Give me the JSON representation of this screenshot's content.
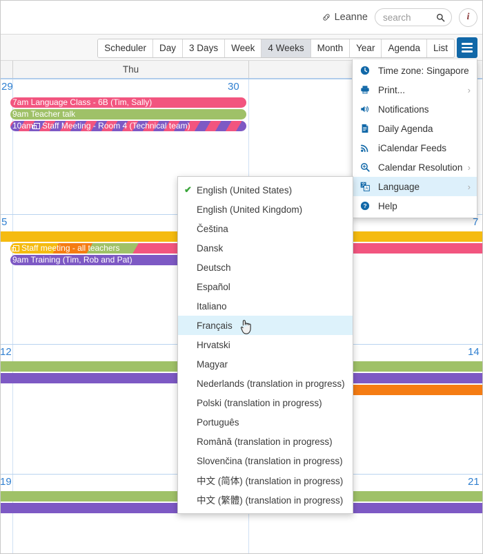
{
  "topbar": {
    "user_name": "Leanne",
    "link_icon": "link-icon",
    "search_placeholder": "search",
    "search_value": "",
    "search_icon": "search-icon",
    "info_label": "i"
  },
  "viewbar": {
    "views": [
      {
        "label": "Scheduler",
        "active": false
      },
      {
        "label": "Day",
        "active": false
      },
      {
        "label": "3 Days",
        "active": false
      },
      {
        "label": "Week",
        "active": false
      },
      {
        "label": "4 Weeks",
        "active": true
      },
      {
        "label": "Month",
        "active": false
      },
      {
        "label": "Year",
        "active": false
      },
      {
        "label": "Agenda",
        "active": false
      },
      {
        "label": "List",
        "active": false
      }
    ],
    "menu_button_icon": "hamburger-icon"
  },
  "calendar": {
    "day_headers": [
      "",
      "Thu",
      ""
    ],
    "weeks": [
      {
        "day_numbers": [
          "29",
          "30",
          ""
        ],
        "events": [
          {
            "title": "7am Language Class - 6B (Tim, Sally)",
            "color": "#f2557f",
            "style": "solid",
            "recurring": false
          },
          {
            "title": "9am Teacher talk",
            "color": "#9fc168",
            "style": "solid",
            "recurring": false
          },
          {
            "title": "10am Staff Meeting - Room 4 (Technical team)",
            "color": "#7d59c4",
            "style": "striped",
            "recurring": true
          }
        ]
      },
      {
        "day_numbers": [
          "5",
          "7"
        ],
        "events": [
          {
            "title": "",
            "color": "#f5bb10",
            "style": "solid",
            "recurring": false
          },
          {
            "title": "Staff meeting - all teachers",
            "color": "#7d59c4",
            "style": "striped-multi",
            "recurring": true
          },
          {
            "title": "9am Training (Tim, Rob and Pat)",
            "color": "#7d59c4",
            "style": "solid",
            "recurring": false
          }
        ]
      },
      {
        "day_numbers": [
          "12",
          "14"
        ],
        "events": [
          {
            "title": "",
            "color": "#9fc168",
            "style": "solid",
            "recurring": false
          },
          {
            "title": "",
            "color": "#7d59c4",
            "style": "solid",
            "recurring": false
          },
          {
            "title": "",
            "color": "#f57c13",
            "style": "solid",
            "recurring": false
          }
        ]
      },
      {
        "day_numbers": [
          "19",
          "21"
        ],
        "events": [
          {
            "title": "",
            "color": "#9fc168",
            "style": "solid",
            "recurring": false
          },
          {
            "title": "",
            "color": "#7d59c4",
            "style": "solid",
            "recurring": false
          }
        ]
      }
    ],
    "week2_right_bars": [
      {
        "color": "#f5bb10"
      },
      {
        "color": "#f2557f"
      }
    ]
  },
  "settings_menu": {
    "items": [
      {
        "label": "Time zone: Singapore",
        "icon": "clock-icon",
        "submenu": false,
        "highlighted": false
      },
      {
        "label": "Print...",
        "icon": "printer-icon",
        "submenu": true,
        "highlighted": false
      },
      {
        "label": "Notifications",
        "icon": "speaker-icon",
        "submenu": false,
        "highlighted": false
      },
      {
        "label": "Daily Agenda",
        "icon": "document-icon",
        "submenu": false,
        "highlighted": false
      },
      {
        "label": "iCalendar Feeds",
        "icon": "rss-icon",
        "submenu": false,
        "highlighted": false
      },
      {
        "label": "Calendar Resolution",
        "icon": "zoom-icon",
        "submenu": true,
        "highlighted": false
      },
      {
        "label": "Language",
        "icon": "translate-icon",
        "submenu": true,
        "highlighted": true
      },
      {
        "label": "Help",
        "icon": "help-icon",
        "submenu": false,
        "highlighted": false
      }
    ],
    "submenu_chevron": "›"
  },
  "language_menu": {
    "check_glyph": "✔",
    "items": [
      {
        "label": "English (United States)",
        "selected": true,
        "highlighted": false
      },
      {
        "label": "English (United Kingdom)",
        "selected": false,
        "highlighted": false
      },
      {
        "label": "Čeština",
        "selected": false,
        "highlighted": false
      },
      {
        "label": "Dansk",
        "selected": false,
        "highlighted": false
      },
      {
        "label": "Deutsch",
        "selected": false,
        "highlighted": false
      },
      {
        "label": "Español",
        "selected": false,
        "highlighted": false
      },
      {
        "label": "Italiano",
        "selected": false,
        "highlighted": false
      },
      {
        "label": "Français",
        "selected": false,
        "highlighted": true
      },
      {
        "label": "Hrvatski",
        "selected": false,
        "highlighted": false
      },
      {
        "label": "Magyar",
        "selected": false,
        "highlighted": false
      },
      {
        "label": "Nederlands (translation in progress)",
        "selected": false,
        "highlighted": false
      },
      {
        "label": "Polski (translation in progress)",
        "selected": false,
        "highlighted": false
      },
      {
        "label": "Português",
        "selected": false,
        "highlighted": false
      },
      {
        "label": "Română (translation in progress)",
        "selected": false,
        "highlighted": false
      },
      {
        "label": "Slovenčina (translation in progress)",
        "selected": false,
        "highlighted": false
      },
      {
        "label": "中文 (简体) (translation in progress)",
        "selected": false,
        "highlighted": false
      },
      {
        "label": "中文 (繁體) (translation in progress)",
        "selected": false,
        "highlighted": false
      }
    ]
  },
  "cursor": {
    "icon": "pointer-hand-cursor"
  },
  "colors": {
    "accent": "#1168a8",
    "daynum": "#2f7fd0",
    "highlight": "#ddf2fb",
    "active_view": "#dcdfe4"
  }
}
